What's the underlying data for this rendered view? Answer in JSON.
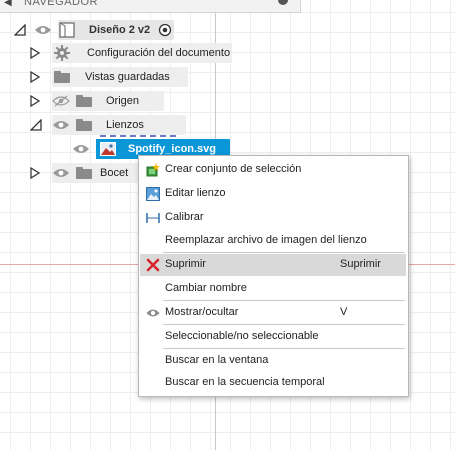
{
  "navigator": {
    "header_title": "NAVEGADOR",
    "root": {
      "label": "Diseño 2 v2"
    },
    "items": [
      {
        "label": "Configuración del documento"
      },
      {
        "label": "Vistas guardadas"
      },
      {
        "label": "Origen"
      },
      {
        "label": "Lienzos"
      },
      {
        "label": "Spotify_icon.svg"
      },
      {
        "label": "Bocet"
      }
    ]
  },
  "context_menu": {
    "items": [
      {
        "label": "Crear conjunto de selección",
        "icon": "selection-set-icon"
      },
      {
        "label": "Editar lienzo",
        "icon": "edit-canvas-icon"
      },
      {
        "label": "Calibrar",
        "icon": "calibrate-icon"
      },
      {
        "label": "Reemplazar archivo de imagen del lienzo"
      },
      {
        "label": "Suprimir",
        "shortcut": "Suprimir",
        "icon": "delete-x-icon"
      },
      {
        "label": "Cambiar nombre"
      },
      {
        "label": "Mostrar/ocultar",
        "shortcut": "V",
        "icon": "eye-icon"
      },
      {
        "label": "Seleccionable/no seleccionable"
      },
      {
        "label": "Buscar en la ventana"
      },
      {
        "label": "Buscar en la secuencia temporal"
      }
    ]
  },
  "colors": {
    "selection_blue": "#0b96d8",
    "delete_red": "#d7262c",
    "origin_axis": "#e7a7a7"
  }
}
